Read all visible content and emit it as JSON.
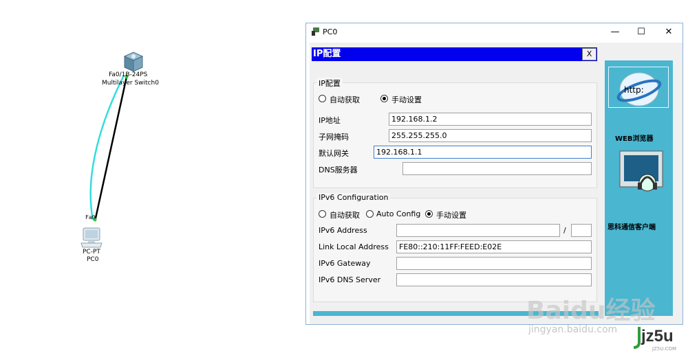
{
  "topology": {
    "switch": {
      "port_label": "Fa0/1",
      "model": "3560-24PS",
      "model_visible": "Fa0/1Ƀ-24PS",
      "type_label": "Multilayer Switch0"
    },
    "pc": {
      "port_label": "Fa0",
      "type": "PC-PT",
      "name": "PC0"
    }
  },
  "window": {
    "title": "PC0",
    "minimize": "—",
    "maximize": "☐",
    "close": "✕"
  },
  "header": {
    "title": "IP配置",
    "close": "X"
  },
  "ipv4": {
    "legend": "IP配置",
    "auto_label": "自动获取",
    "manual_label": "手动设置",
    "mode": "manual",
    "ip_label": "IP地址",
    "ip_value": "192.168.1.2",
    "mask_label": "子网掩码",
    "mask_value": "255.255.255.0",
    "gateway_label": "默认网关",
    "gateway_value": "192.168.1.1",
    "dns_label": "DNS服务器",
    "dns_value": ""
  },
  "ipv6": {
    "legend": "IPv6 Configuration",
    "auto_label": "自动获取",
    "autoconfig_label": "Auto Config",
    "manual_label": "手动设置",
    "mode": "manual",
    "address_label": "IPv6 Address",
    "address_value": "",
    "prefix_sep": "/",
    "prefix_value": "",
    "link_local_label": "Link Local Address",
    "link_local_value": "FE80::210:11FF:FEED:E02E",
    "gateway_label": "IPv6 Gateway",
    "gateway_value": "",
    "dns_label": "IPv6 DNS Server",
    "dns_value": ""
  },
  "sidebar": {
    "browser_icon_text": "http:",
    "browser_label": "WEB浏览器",
    "client_label": "思科通信客户端"
  },
  "watermarks": {
    "baidu": "Baidu经验",
    "baidu_url": "jingyan.baidu.com",
    "jz5u": "jz5u",
    "jz5u_url": "JZ5U.COM"
  },
  "colors": {
    "title_bar_blue": "#0000ee",
    "sidebar_cyan": "#4ab6d0",
    "link_cyan": "#33dddd",
    "focus_border": "#3c7fd1"
  }
}
